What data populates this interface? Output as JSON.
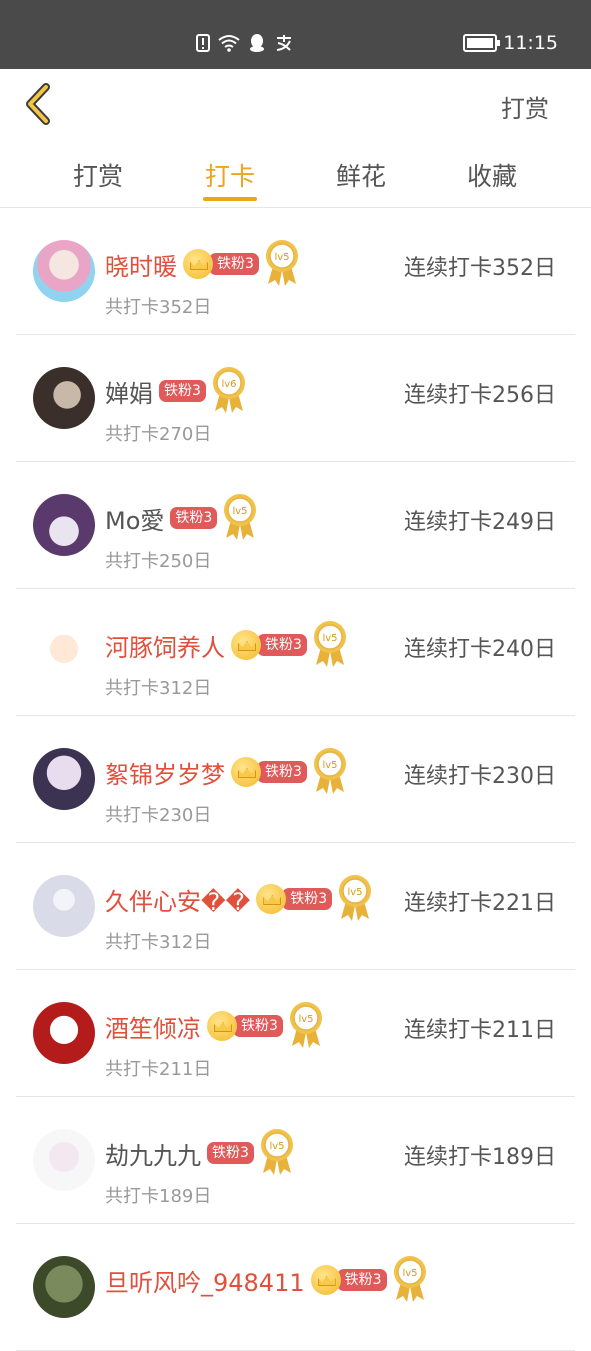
{
  "status_bar": {
    "time": "11:15"
  },
  "header": {
    "right_label": "打赏"
  },
  "tabs": [
    {
      "label": "打赏",
      "active": false
    },
    {
      "label": "打卡",
      "active": true
    },
    {
      "label": "鲜花",
      "active": false
    },
    {
      "label": "收藏",
      "active": false
    }
  ],
  "colors": {
    "accent": "#f2a21c",
    "name_red": "#e0503c",
    "fan_badge": "#e05a5a"
  },
  "rows": [
    {
      "name": "晓时暖",
      "vip": true,
      "badge": "铁粉3",
      "level": "lv5",
      "total": "共打卡352日",
      "streak": "连续打卡352日"
    },
    {
      "name": "婵娟",
      "vip": false,
      "badge": "铁粉3",
      "level": "lv6",
      "total": "共打卡270日",
      "streak": "连续打卡256日"
    },
    {
      "name": "Mo愛",
      "vip": false,
      "badge": "铁粉3",
      "level": "lv5",
      "total": "共打卡250日",
      "streak": "连续打卡249日"
    },
    {
      "name": "河豚饲养人",
      "vip": true,
      "badge": "铁粉3",
      "level": "lv5",
      "total": "共打卡312日",
      "streak": "连续打卡240日"
    },
    {
      "name": "絮锦岁岁梦",
      "vip": true,
      "badge": "铁粉3",
      "level": "lv5",
      "total": "共打卡230日",
      "streak": "连续打卡230日"
    },
    {
      "name": "久伴心安��",
      "vip": true,
      "badge": "铁粉3",
      "level": "lv5",
      "total": "共打卡312日",
      "streak": "连续打卡221日"
    },
    {
      "name": "酒笙倾凉",
      "vip": true,
      "badge": "铁粉3",
      "level": "lv5",
      "total": "共打卡211日",
      "streak": "连续打卡211日"
    },
    {
      "name": "劫九九九",
      "vip": false,
      "badge": "铁粉3",
      "level": "lv5",
      "total": "共打卡189日",
      "streak": "连续打卡189日"
    },
    {
      "name": "旦听风吟_948411",
      "vip": true,
      "badge": "铁粉3",
      "level": "lv5",
      "total": "",
      "streak": ""
    }
  ]
}
